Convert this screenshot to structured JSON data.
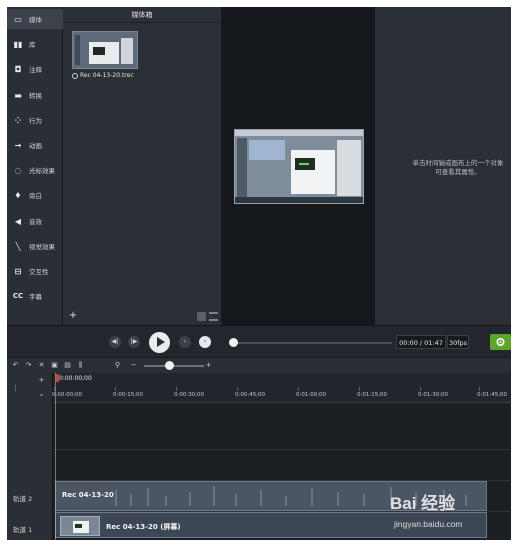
{
  "sidebar": {
    "items": [
      {
        "label": "媒体",
        "icon": "media-icon",
        "active": true
      },
      {
        "label": "库",
        "icon": "library-icon"
      },
      {
        "label": "注释",
        "icon": "annotation-icon"
      },
      {
        "label": "转换",
        "icon": "transition-icon"
      },
      {
        "label": "行为",
        "icon": "behavior-icon"
      },
      {
        "label": "动画",
        "icon": "animation-icon"
      },
      {
        "label": "光标效果",
        "icon": "cursor-effect-icon"
      },
      {
        "label": "旁白",
        "icon": "microphone-icon"
      },
      {
        "label": "音效",
        "icon": "speaker-icon"
      },
      {
        "label": "视觉效果",
        "icon": "magic-wand-icon"
      },
      {
        "label": "交互性",
        "icon": "interactive-icon"
      },
      {
        "label": "字幕",
        "icon": "captions-icon"
      }
    ]
  },
  "media_bin": {
    "title": "媒体箱",
    "clip_label": "Rec 04-13-20.trec"
  },
  "properties": {
    "hint_line1": "单击时间轴或画布上的一个对象",
    "hint_line2": "可查看其属性。"
  },
  "playback": {
    "time": "00:00 / 01:47",
    "fps": "30fps"
  },
  "timeline": {
    "playhead_time": "0:00:00;00",
    "ticks": [
      "0:00:00;00",
      "0:00:15;00",
      "0:00:30;00",
      "0:00:45;00",
      "0:01:00;00",
      "0:01:15;00",
      "0:01:30;00",
      "0:01:45;00"
    ],
    "tracks": [
      {
        "label": "轨道 2",
        "clip": "Rec 04-13-20"
      },
      {
        "label": "轨道 1",
        "clip": "Rec 04-13-20 (屏幕)"
      }
    ]
  },
  "watermark": {
    "logo_text": "Bai 经验",
    "url": "jingyan.baidu.com"
  },
  "colors": {
    "accent_green": "#5ea52b",
    "playhead_red": "#d43d3d"
  }
}
